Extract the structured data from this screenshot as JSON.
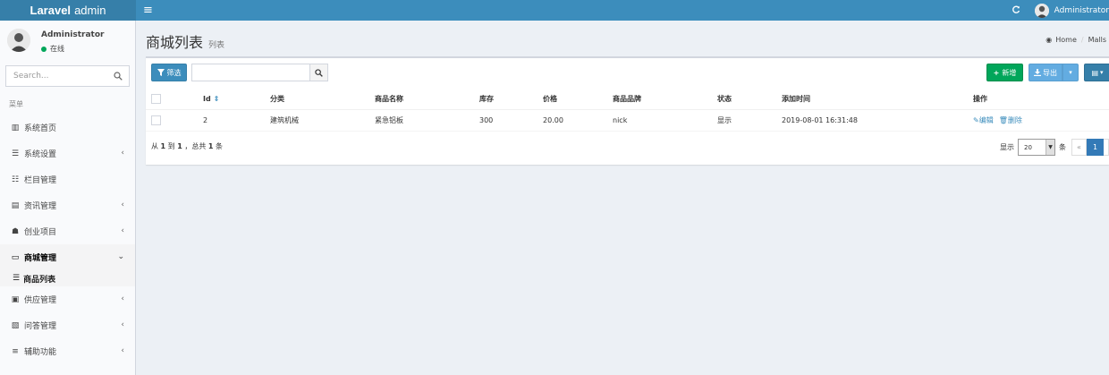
{
  "app": {
    "logo_bold": "Laravel",
    "logo_rest": "admin"
  },
  "navbar": {
    "user_name": "Administrator"
  },
  "sidebar": {
    "user_name": "Administrator",
    "status": "在线",
    "search_placeholder": "Search...",
    "menu_header": "菜单",
    "items": [
      {
        "label": "系统首页",
        "icon": "bar-chart-icon"
      },
      {
        "label": "系统设置",
        "icon": "list-icon"
      },
      {
        "label": "栏目管理",
        "icon": "database-icon"
      },
      {
        "label": "资讯管理",
        "icon": "book-icon"
      },
      {
        "label": "创业项目",
        "icon": "users-icon"
      },
      {
        "label": "商城管理",
        "icon": "desktop-icon"
      },
      {
        "label": "商品列表",
        "icon": "list-icon"
      },
      {
        "label": "供应管理",
        "icon": "bus-icon"
      },
      {
        "label": "问答管理",
        "icon": "map-icon"
      },
      {
        "label": "辅助功能",
        "icon": "sliders-icon"
      }
    ]
  },
  "header": {
    "title": "商城列表",
    "subtitle": "列表",
    "breadcrumb": [
      "Home",
      "Malls"
    ]
  },
  "toolbar": {
    "filter_label": "筛选",
    "new_label": "新增",
    "export_label": "导出"
  },
  "table": {
    "columns": [
      "Id",
      "分类",
      "商品名称",
      "库存",
      "价格",
      "商品品牌",
      "状态",
      "添加时间",
      "操作"
    ],
    "rows": [
      {
        "id": "2",
        "category": "建筑机械",
        "name": "紧急铝板",
        "stock": "300",
        "price": "20.00",
        "brand": "nick",
        "status": "显示",
        "created": "2019-08-01 16:31:48",
        "edit": "编辑",
        "delete": "删除"
      }
    ]
  },
  "footer": {
    "summary_pre": "从",
    "summary_from": "1",
    "summary_mid": "到",
    "summary_to": "1",
    "summary_total_pre": "，总共",
    "summary_total": "1",
    "summary_post": "条",
    "per_page_label": "显示",
    "per_page_value": "20",
    "per_page_unit": "条",
    "prev": "«",
    "current_page": "1"
  },
  "colors": {
    "navbar": "#3c8dbc",
    "logo_bg": "#367fa9",
    "new_button": "#00a65a",
    "export_button": "#63ace1",
    "category_text": "#dd4b39"
  }
}
